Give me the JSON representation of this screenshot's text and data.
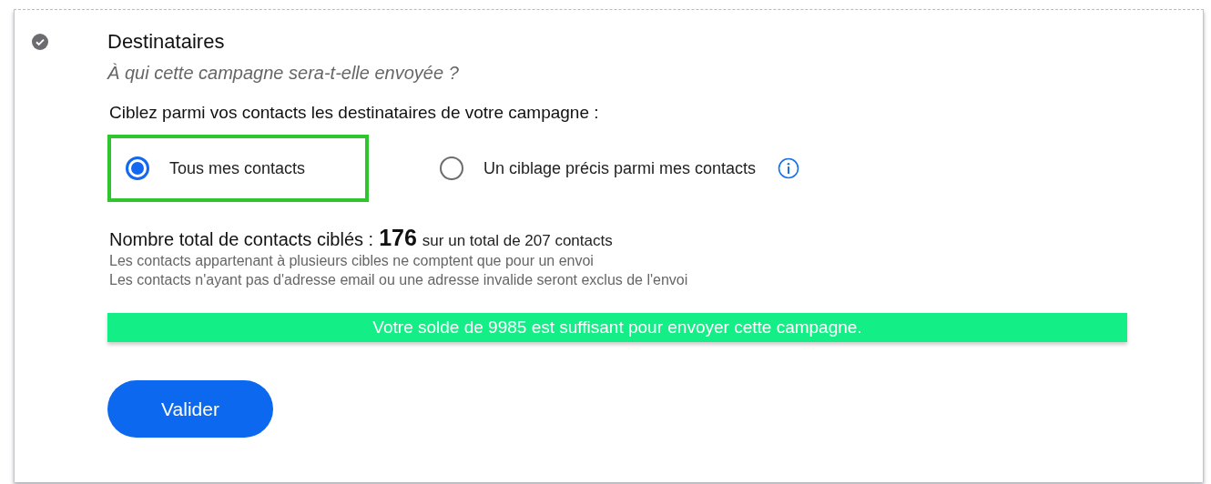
{
  "section": {
    "done": true,
    "title": "Destinataires",
    "subtitle": "À qui cette campagne sera-t-elle envoyée ?"
  },
  "targeting": {
    "prompt": "Ciblez parmi vos contacts les destinataires de votre campagne :",
    "options": [
      {
        "label": "Tous mes contacts",
        "selected": true,
        "highlighted": true,
        "info": false
      },
      {
        "label": "Un ciblage précis parmi mes contacts",
        "selected": false,
        "highlighted": false,
        "info": true
      }
    ]
  },
  "total": {
    "label": "Nombre total de contacts ciblés :",
    "count": "176",
    "suffix": "sur un total de 207 contacts",
    "notes": [
      "Les contacts appartenant à plusieurs cibles ne comptent que pour un envoi",
      "Les contacts n'ayant pas d'adresse email ou une adresse invalide seront exclus de l'envoi"
    ]
  },
  "balance_banner": "Votre solde de 9985 est suffisant pour envoyer cette campagne.",
  "buttons": [
    "Valider"
  ]
}
